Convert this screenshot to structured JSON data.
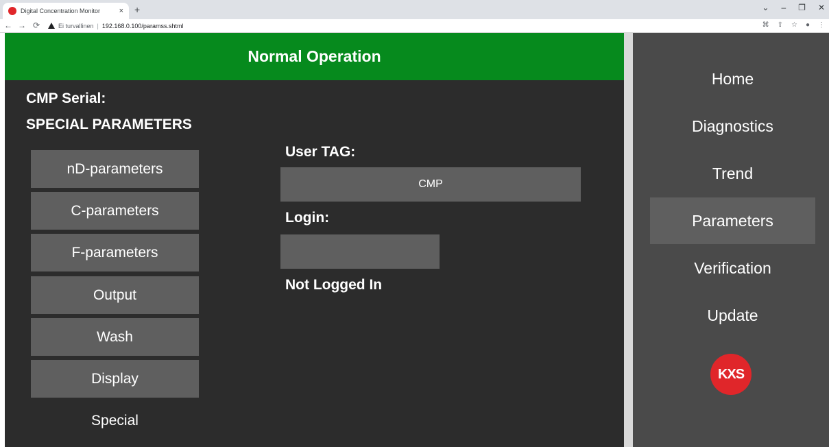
{
  "browser": {
    "tab_title": "Digital Concentration Monitor",
    "tab_close": "×",
    "new_tab": "+",
    "security_label": "Ei turvallinen",
    "url": "192.168.0.100/paramss.shtml"
  },
  "status": {
    "text": "Normal Operation",
    "color": "#068a1d"
  },
  "header": {
    "serial_label": "CMP Serial:",
    "section_title": "SPECIAL PARAMETERS"
  },
  "param_menu": {
    "items": [
      {
        "label": "nD-parameters"
      },
      {
        "label": "C-parameters"
      },
      {
        "label": "F-parameters"
      },
      {
        "label": "Output"
      },
      {
        "label": "Wash"
      },
      {
        "label": "Display"
      }
    ],
    "current": "Special"
  },
  "form": {
    "user_tag_label": "User TAG:",
    "user_tag_value": "CMP",
    "login_label": "Login:",
    "login_value": "",
    "login_status": "Not Logged In"
  },
  "sidebar": {
    "items": [
      {
        "label": "Home",
        "active": false
      },
      {
        "label": "Diagnostics",
        "active": false
      },
      {
        "label": "Trend",
        "active": false
      },
      {
        "label": "Parameters",
        "active": true
      },
      {
        "label": "Verification",
        "active": false
      },
      {
        "label": "Update",
        "active": false
      }
    ],
    "logo_text": "KXS",
    "logo_color": "#e0262a"
  }
}
